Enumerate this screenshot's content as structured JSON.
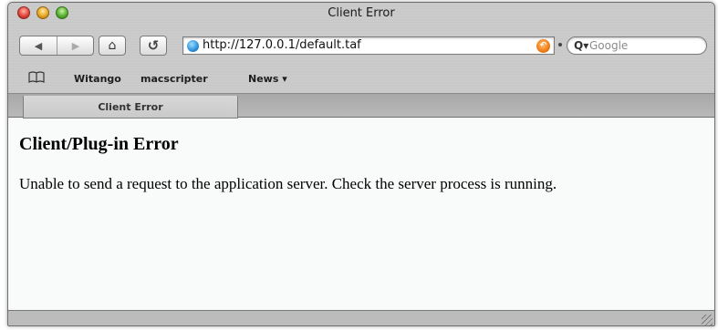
{
  "window": {
    "title": "Client Error"
  },
  "toolbar": {
    "back_icon": "◀",
    "forward_icon": "▶",
    "home_icon": "⌂",
    "reload_icon": "↺",
    "url": "http://127.0.0.1/default.taf",
    "snapback_icon": "↶",
    "search_icon": "Q▾",
    "search_placeholder": "Google"
  },
  "bookmarks": {
    "book_icon": "🕮",
    "items": [
      {
        "label": "Witango"
      },
      {
        "label": "macscripter"
      },
      {
        "label": "News ▾"
      }
    ]
  },
  "tabs": [
    {
      "label": "Client Error",
      "active": true
    }
  ],
  "page": {
    "heading": "Client/Plug-in Error",
    "message": "Unable to send a request to the application server. Check the server process is running."
  },
  "colors": {
    "close": "#e0453a",
    "minimize": "#e6a623",
    "zoom": "#58b032",
    "content_bg": "#f9fbfb"
  }
}
